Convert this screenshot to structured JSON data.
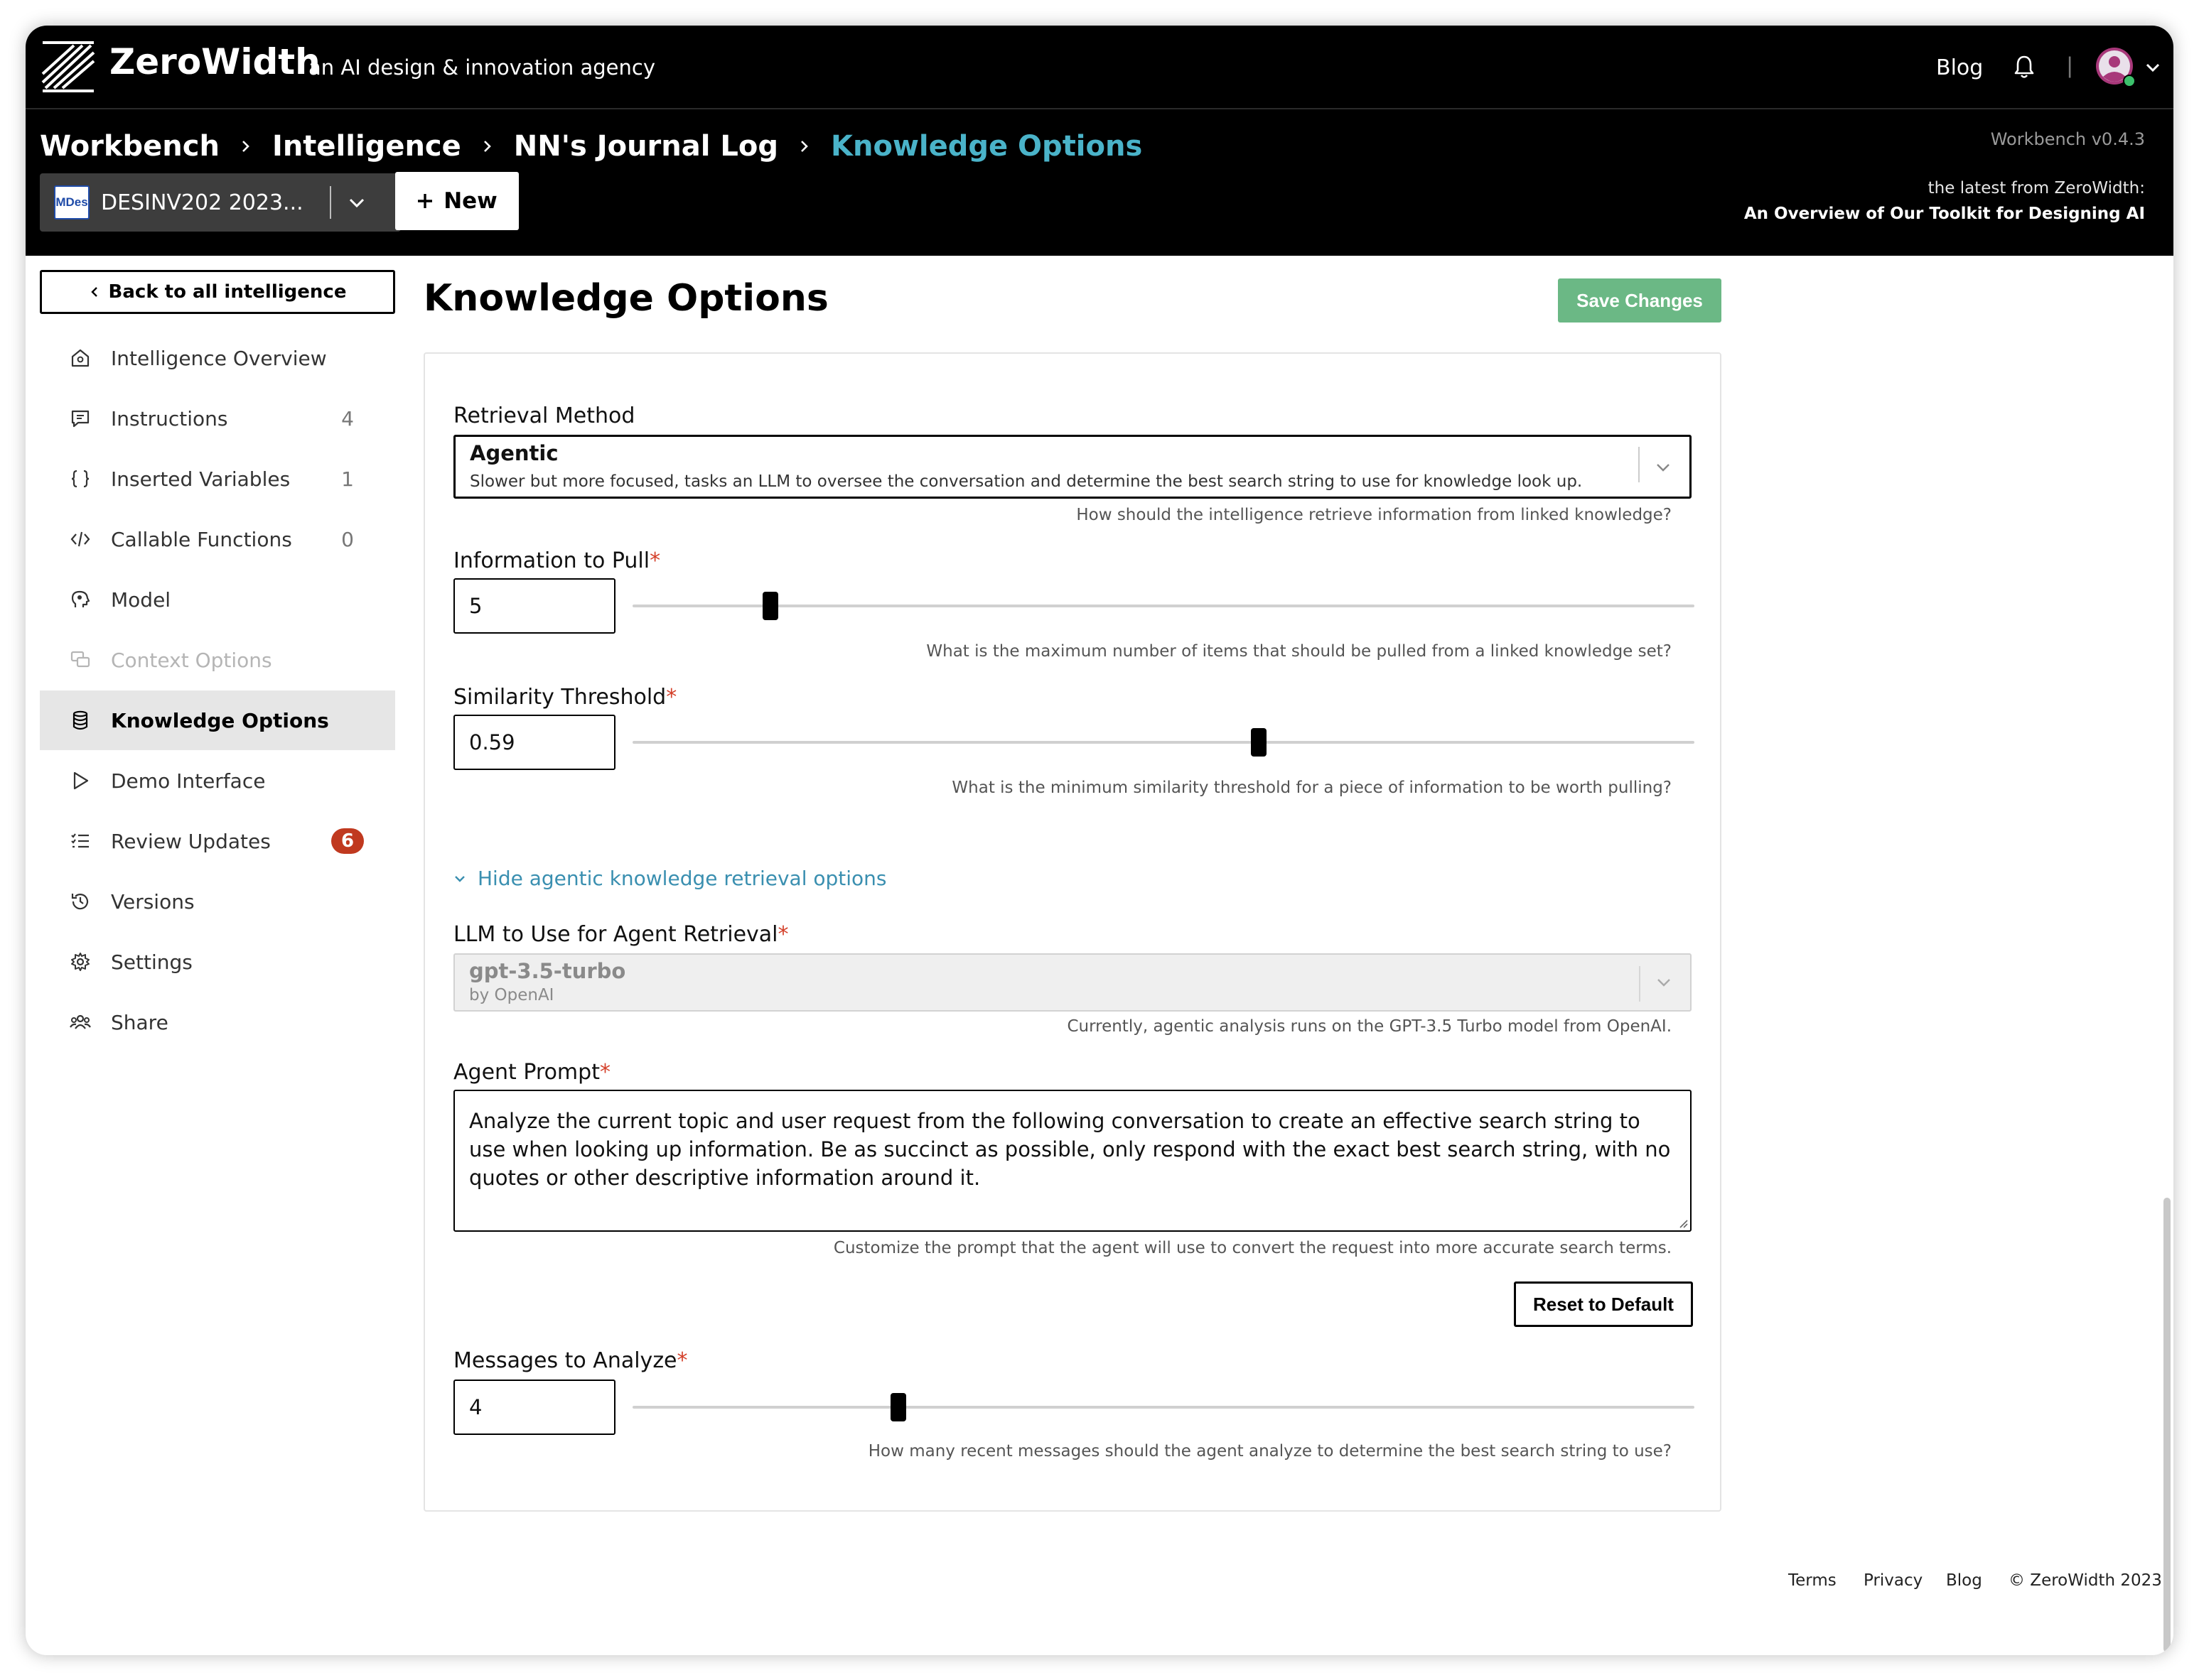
{
  "header": {
    "brand": "ZeroWidth",
    "tagline": "an AI design & innovation agency",
    "nav_blog": "Blog",
    "separator": "|",
    "icons": [
      "zerowidth-logo-icon",
      "bell-icon",
      "user-avatar-icon",
      "chevron-down-icon"
    ]
  },
  "breadcrumb": {
    "items": [
      "Workbench",
      "Intelligence",
      "NN's Journal Log",
      "Knowledge Options"
    ]
  },
  "version": "Workbench v0.4.3",
  "latest": {
    "label": "the latest from ZeroWidth:",
    "link": "An Overview of Our Toolkit for Designing AI"
  },
  "project": {
    "badge": "MDes",
    "name": "DESINV202 2023..."
  },
  "new_button": "New",
  "sidebar": {
    "back": "Back to all intelligence",
    "items": [
      {
        "label": "Intelligence Overview",
        "icon": "home-gear-icon",
        "count": ""
      },
      {
        "label": "Instructions",
        "icon": "message-square-icon",
        "count": "4"
      },
      {
        "label": "Inserted Variables",
        "icon": "braces-icon",
        "count": "1"
      },
      {
        "label": "Callable Functions",
        "icon": "code-icon",
        "count": "0"
      },
      {
        "label": "Model",
        "icon": "brain-head-icon",
        "count": ""
      },
      {
        "label": "Context Options",
        "icon": "chat-bubbles-icon",
        "count": ""
      },
      {
        "label": "Knowledge Options",
        "icon": "database-icon",
        "count": ""
      },
      {
        "label": "Demo Interface",
        "icon": "play-icon",
        "count": ""
      },
      {
        "label": "Review Updates",
        "icon": "checklist-icon",
        "count": "6"
      },
      {
        "label": "Versions",
        "icon": "history-icon",
        "count": ""
      },
      {
        "label": "Settings",
        "icon": "gear-icon",
        "count": ""
      },
      {
        "label": "Share",
        "icon": "users-icon",
        "count": ""
      }
    ]
  },
  "main": {
    "title": "Knowledge Options",
    "save": "Save Changes",
    "retrieval": {
      "label": "Retrieval Method",
      "value": "Agentic",
      "description": "Slower but more focused, tasks an LLM to oversee the conversation and determine the best search string to use for knowledge look up.",
      "help": "How should the intelligence retrieve information from linked knowledge?"
    },
    "info_pull": {
      "label": "Information to Pull",
      "required": "*",
      "value": "5",
      "slider_fraction": 0.13,
      "help": "What is the maximum number of items that should be pulled from a linked knowledge set?"
    },
    "similarity": {
      "label": "Similarity Threshold",
      "required": "*",
      "value": "0.59",
      "slider_fraction": 0.59,
      "help": "What is the minimum similarity threshold for a piece of information to be worth pulling?"
    },
    "toggle": "Hide agentic knowledge retrieval options",
    "llm": {
      "label": "LLM to Use for Agent Retrieval",
      "required": "*",
      "value": "gpt-3.5-turbo",
      "provider": "by OpenAI",
      "help": "Currently, agentic analysis runs on the GPT-3.5 Turbo model from OpenAI."
    },
    "agent_prompt": {
      "label": "Agent Prompt",
      "required": "*",
      "value": "Analyze the current topic and user request from the following conversation to create an effective search string to use when looking up information. Be as succinct as possible, only respond with the exact best search string, with no quotes or other descriptive information around it.",
      "help": "Customize the prompt that the agent will use to convert the request into more accurate search terms."
    },
    "reset": "Reset to Default",
    "messages": {
      "label": "Messages to Analyze",
      "required": "*",
      "value": "4",
      "slider_fraction": 0.25,
      "help": "How many recent messages should the agent analyze to determine the best search string to use?"
    }
  },
  "footer": {
    "links": [
      "Terms",
      "Privacy",
      "Blog"
    ],
    "copyright": "© ZeroWidth 2023"
  },
  "colors": {
    "header_bg": "#000000",
    "accent_teal": "#4ab3c9",
    "save_green": "#6bb885",
    "badge_red": "#c0391f",
    "link_blue": "#3a8fb0"
  }
}
